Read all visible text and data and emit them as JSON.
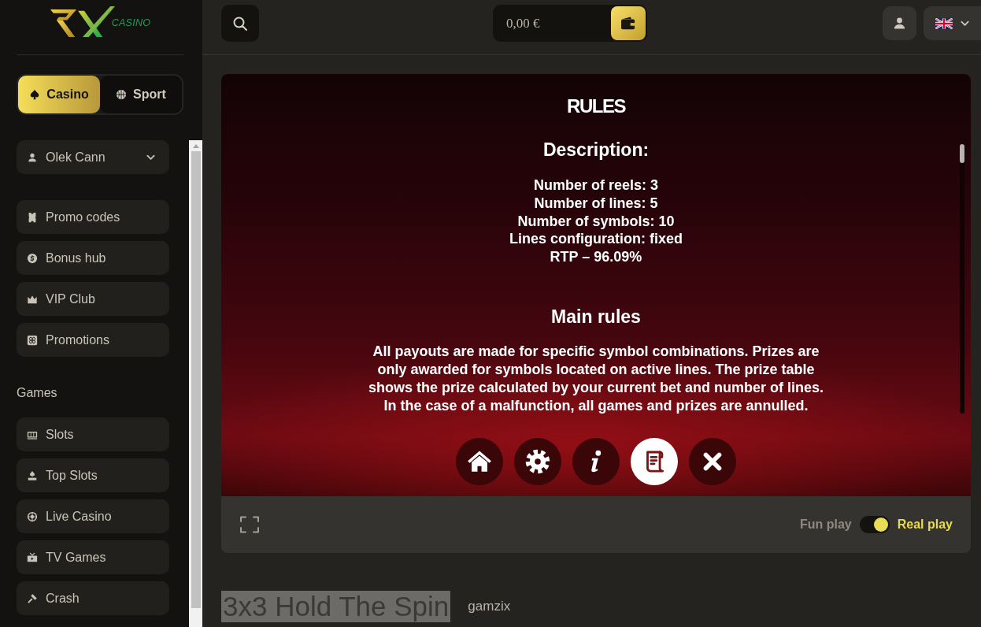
{
  "logo": {
    "text": "CASINO"
  },
  "mode_tabs": [
    {
      "label": "Casino",
      "selected": true
    },
    {
      "label": "Sport",
      "selected": false
    }
  ],
  "user_menu": {
    "name": "Olek Cann",
    "expanded": false
  },
  "nav_items": [
    {
      "label": "Promo codes"
    },
    {
      "label": "Bonus hub"
    },
    {
      "label": "VIP Club"
    },
    {
      "label": "Promotions"
    }
  ],
  "games_section": {
    "title": "Games",
    "items": [
      {
        "label": "Slots"
      },
      {
        "label": "Top Slots"
      },
      {
        "label": "Live Casino"
      },
      {
        "label": "TV Games"
      },
      {
        "label": "Crash"
      }
    ]
  },
  "top_bar": {
    "balance": "0,00 €"
  },
  "game": {
    "heading": "RULES",
    "description_title": "Description:",
    "description_lines": [
      "Number of reels: 3",
      "Number of lines: 5",
      "Number of symbols: 10",
      "Lines configuration: fixed",
      "RTP – 96.09%"
    ],
    "rules_title": "Main rules",
    "rules_lines": [
      "All payouts are made for specific symbol combinations. Prizes are",
      "only awarded for symbols located on active lines. The prize table",
      "shows the prize calculated by your current bet and number of lines.",
      "In the case of a malfunction, all games and prizes are annulled."
    ],
    "menu_buttons": [
      {
        "selected": false
      },
      {
        "selected": false
      },
      {
        "selected": false
      },
      {
        "selected": true
      },
      {
        "selected": false
      }
    ]
  },
  "play_mode": {
    "fun_label": "Fun play",
    "real_label": "Real play",
    "real": true
  },
  "game_info": {
    "title": "3x3 Hold The Spin",
    "provider": "gamzix"
  }
}
